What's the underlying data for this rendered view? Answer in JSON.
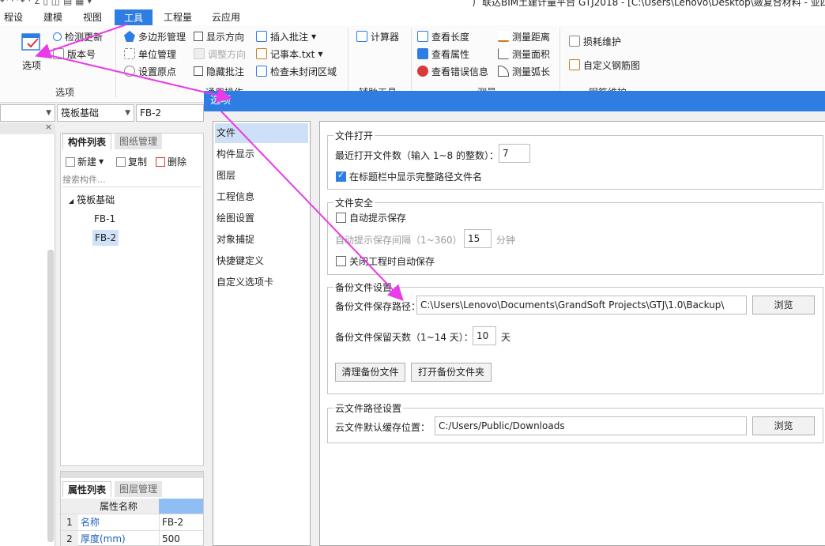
{
  "titlebar": {
    "quick_access": "↶ · ↷ · Σ ▯ ◫ ▤ ▦ ▾",
    "title": "广联达BIM土建计量平台 GTJ2018 - [C:\\Users\\Lenovo\\Desktop\\皴复合材料 - 亚四."
  },
  "menu": [
    "程设置",
    "建模",
    "视图",
    "工具",
    "工程量",
    "云应用"
  ],
  "ribbon": {
    "options_button": "选项",
    "check_update": "检测更新",
    "version": "版本号",
    "group_options": "选项",
    "polygon_mgmt": "多边形管理",
    "unit_mgmt": "单位管理",
    "set_origin": "设置原点",
    "show_direction": "显示方向",
    "adjust_direction": "调整方向",
    "hide_annotation": "隐藏批注",
    "insert_annotation": "插入批注",
    "notepad": "记事本.txt",
    "check_unclosed": "检查未封闭区域",
    "group_common": "通用操作",
    "calculator": "计算器",
    "group_aux": "辅助工具",
    "view_length": "查看长度",
    "view_props": "查看属性",
    "view_errors": "查看错误信息",
    "measure_distance": "测量距离",
    "measure_area": "测量面积",
    "measure_arc": "测量弧长",
    "group_measure": "测量",
    "loss_maint": "损耗维护",
    "custom_rebar": "自定义钢筋图",
    "group_rebar": "钢筋维护"
  },
  "left": {
    "combo_type": "筏板基础",
    "combo_item": "FB-2",
    "tab_components": "构件列表",
    "tab_drawings": "图纸管理",
    "btn_new": "新建",
    "btn_copy": "复制",
    "btn_delete": "删除",
    "search_placeholder": "搜索构件...",
    "tree_root": "筏板基础",
    "tree_items": [
      "FB-1",
      "FB-2"
    ],
    "tab_props": "属性列表",
    "tab_layers": "图层管理",
    "prop_header": "属性名称",
    "props": [
      {
        "no": "1",
        "name": "名称",
        "value": "FB-2"
      },
      {
        "no": "2",
        "name": "厚度(mm)",
        "value": "500"
      }
    ]
  },
  "dialog": {
    "title": "选项",
    "nav": [
      "文件",
      "构件显示",
      "图层",
      "工程信息",
      "绘图设置",
      "对象捕捉",
      "快捷键定义",
      "自定义选项卡"
    ],
    "file_open": {
      "legend": "文件打开",
      "recent_label": "最近打开文件数（输入 1~8 的整数）：",
      "recent_value": "7",
      "show_full_path": "在标题栏中显示完整路径文件名"
    },
    "file_security": {
      "legend": "文件安全",
      "auto_prompt": "自动提示保存",
      "interval_label": "自动提示保存间隔（1~360）",
      "interval_value": "15",
      "interval_unit": "分钟",
      "autosave_on_close": "关闭工程时自动保存"
    },
    "backup": {
      "legend": "备份文件设置",
      "path_label": "备份文件保存路径：",
      "path_value": "C:\\Users\\Lenovo\\Documents\\GrandSoft Projects\\GTJ\\1.0\\Backup\\",
      "browse": "浏览",
      "days_label": "备份文件保留天数（1~14 天）：",
      "days_value": "10",
      "days_unit": "天",
      "clear": "清理备份文件",
      "open_folder": "打开备份文件夹"
    },
    "cloud": {
      "legend": "云文件路径设置",
      "cache_label": "云文件默认缓存位置：",
      "cache_value": "C:/Users/Public/Downloads",
      "browse": "浏览"
    }
  },
  "colors": {
    "accent": "#2d7de3",
    "annotation": "#e83ce8"
  }
}
